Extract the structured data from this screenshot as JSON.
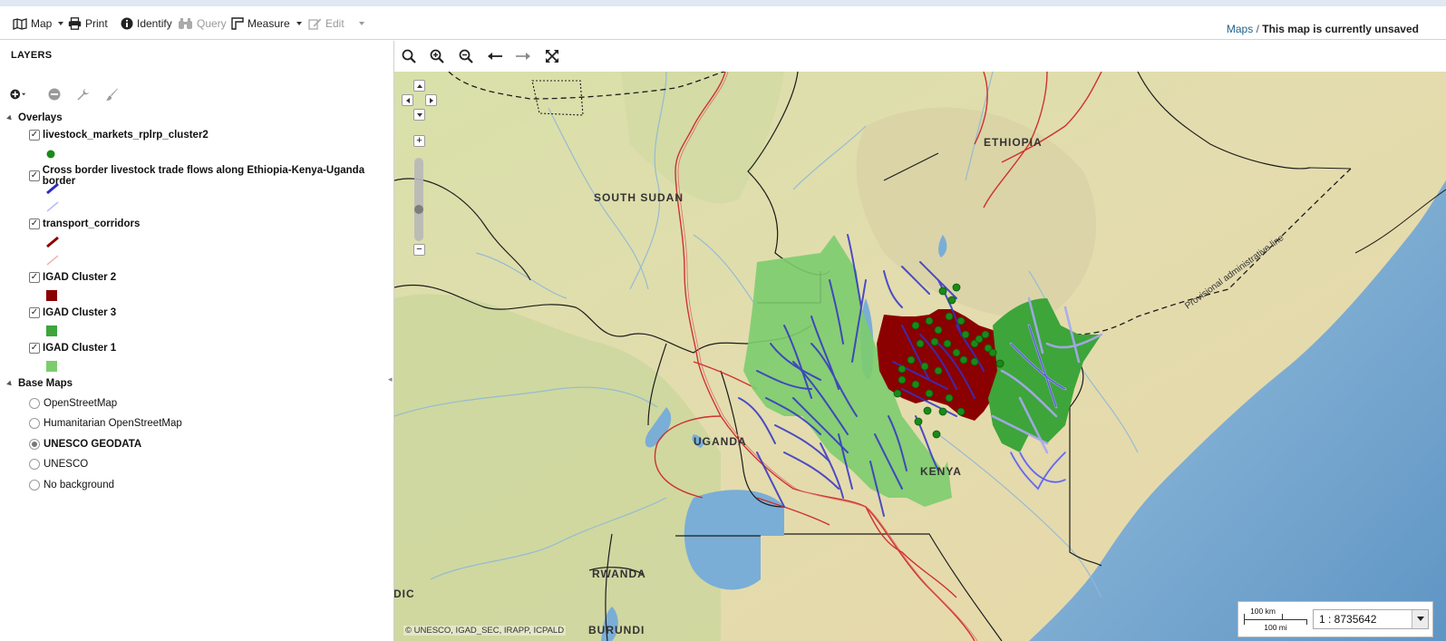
{
  "toolbar": {
    "map_label": "Map",
    "print_label": "Print",
    "identify_label": "Identify",
    "query_label": "Query",
    "measure_label": "Measure",
    "edit_label": "Edit"
  },
  "breadcrumb": {
    "root": "Maps",
    "separator": "/",
    "current": "This map is currently unsaved"
  },
  "sidebar": {
    "title": "LAYERS",
    "overlays": {
      "label": "Overlays",
      "layers": [
        {
          "name": "livestock_markets_rplrp_cluster2",
          "checked": true
        },
        {
          "name": "Cross border livestock trade flows along Ethiopia-Kenya-Uganda border",
          "checked": true
        },
        {
          "name": "transport_corridors",
          "checked": true
        },
        {
          "name": "IGAD Cluster 2",
          "checked": true
        },
        {
          "name": "IGAD Cluster 3",
          "checked": true
        },
        {
          "name": "IGAD Cluster 1",
          "checked": true
        }
      ]
    },
    "base_maps": {
      "label": "Base Maps",
      "options": [
        {
          "name": "OpenStreetMap",
          "selected": false
        },
        {
          "name": "Humanitarian OpenStreetMap",
          "selected": false
        },
        {
          "name": "UNESCO GEODATA",
          "selected": true
        },
        {
          "name": "UNESCO",
          "selected": false
        },
        {
          "name": "No background",
          "selected": false
        }
      ]
    }
  },
  "map": {
    "labels": {
      "south_sudan": "SOUTH SUDAN",
      "ethiopia": "ETHIOPIA",
      "uganda": "UGANDA",
      "kenya": "KENYA",
      "rwanda": "RWANDA",
      "burundi": "BURUNDI",
      "edge_label": "DIC",
      "boundary_note": "Provisional administrative line"
    },
    "attribution": "© UNESCO, IGAD_SEC, IRAPP, ICPALD",
    "scale": {
      "km_label": "100 km",
      "mi_label": "100 mi",
      "ratio": "1 : 8735642"
    }
  },
  "colors": {
    "cluster1": "#7ccc6e",
    "cluster2": "#8b0000",
    "cluster3": "#3da53a",
    "markets": "#1a8a1a",
    "trade_flows": "#2b2bbf",
    "transport": "#8b0000",
    "water": "#7aaed6",
    "accent_link": "#1f5f8b"
  }
}
